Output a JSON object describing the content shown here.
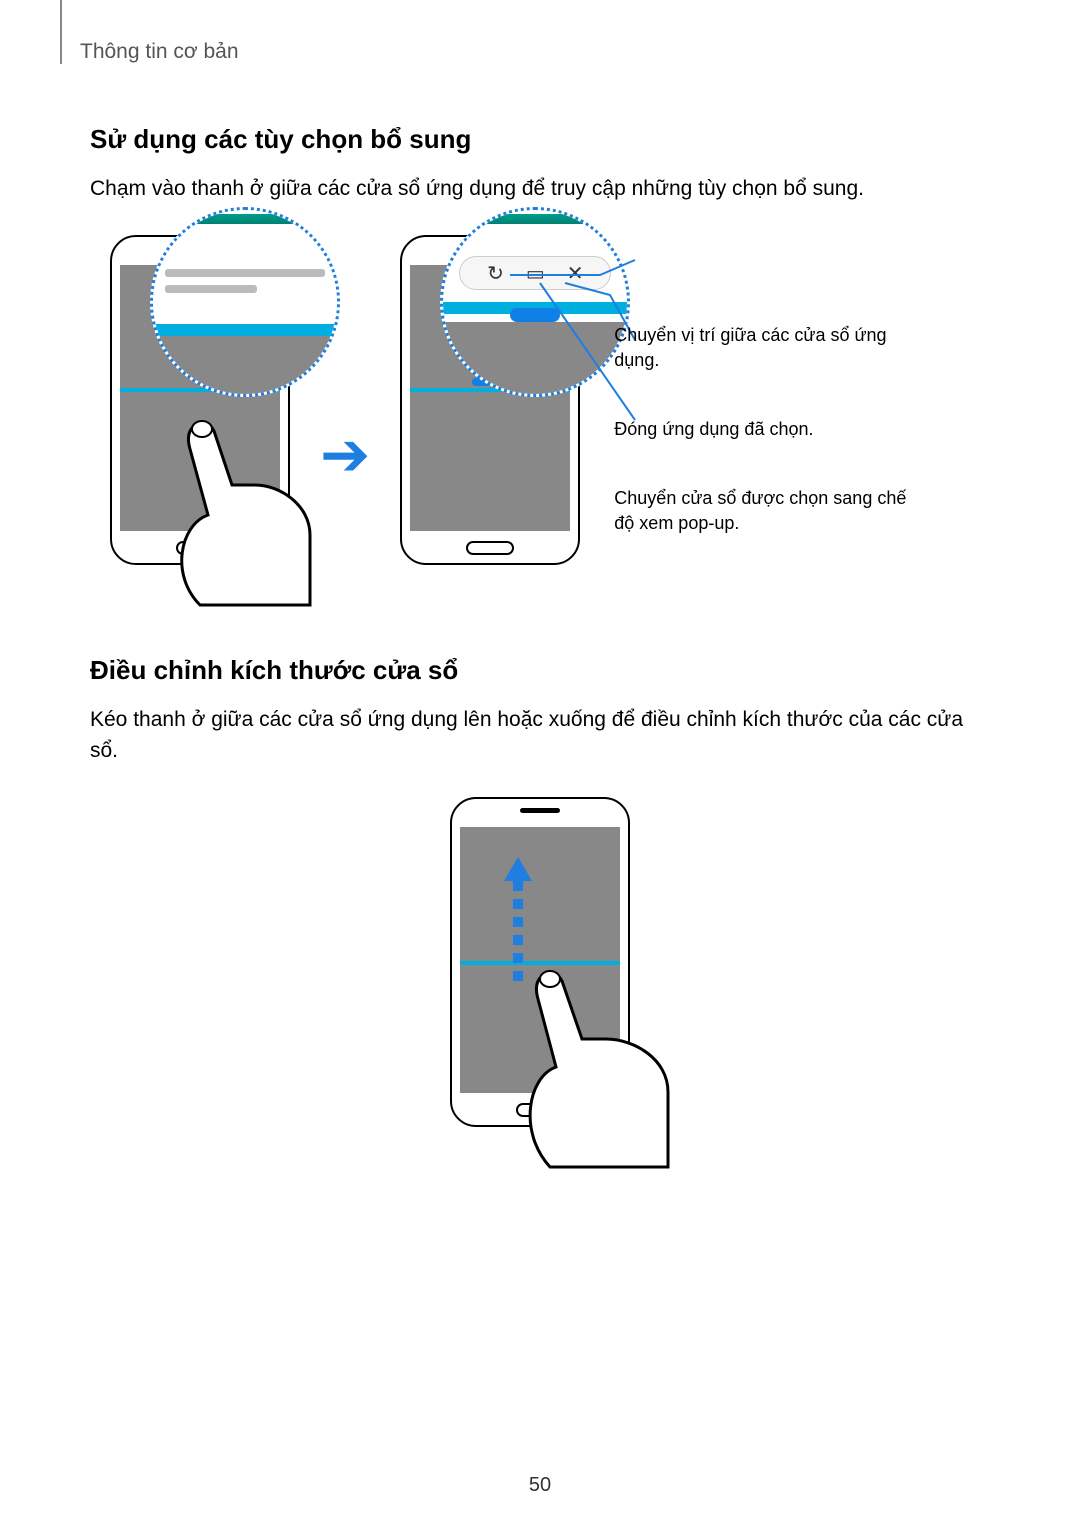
{
  "header": {
    "breadcrumb": "Thông tin cơ bản"
  },
  "section1": {
    "title": "Sử dụng các tùy chọn bổ sung",
    "body": "Chạm vào thanh ở giữa các cửa sổ ứng dụng để truy cập những tùy chọn bổ sung."
  },
  "callouts": {
    "swap": "Chuyển vị trí giữa các cửa sổ ứng dụng.",
    "close": "Đóng ứng dụng đã chọn.",
    "popup": "Chuyển cửa sổ được chọn sang chế độ xem pop-up."
  },
  "section2": {
    "title": "Điều chỉnh kích thước cửa sổ",
    "body": "Kéo thanh ở giữa các cửa sổ ứng dụng lên hoặc xuống để điều chỉnh kích thước của các cửa sổ."
  },
  "page_number": "50",
  "icons": {
    "swap_glyph": "↻",
    "popup_glyph": "▭",
    "close_glyph": "✕",
    "arrow_right_glyph": "➔"
  }
}
